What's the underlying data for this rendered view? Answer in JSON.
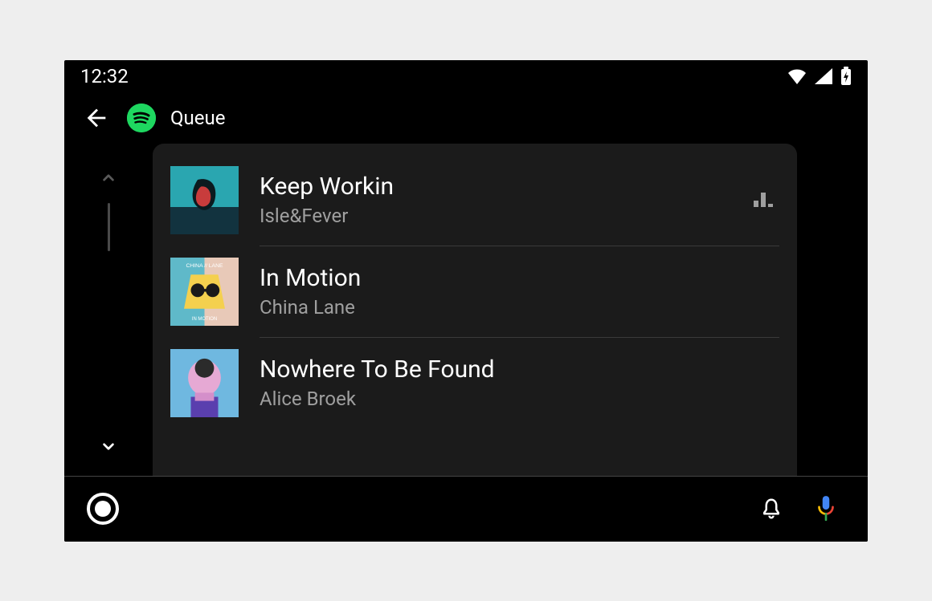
{
  "statusbar": {
    "time": "12:32"
  },
  "header": {
    "title": "Queue",
    "app_icon": "spotify-icon",
    "back_icon": "arrow-left-icon"
  },
  "queue": {
    "now_playing_indicator": "equalizer-icon",
    "tracks": [
      {
        "title": "Keep Workin",
        "artist": "Isle&Fever",
        "playing": true
      },
      {
        "title": "In Motion",
        "artist": "China Lane",
        "playing": false
      },
      {
        "title": "Nowhere To Be Found",
        "artist": "Alice Broek",
        "playing": false
      }
    ]
  },
  "scroll": {
    "up_icon": "chevron-up-icon",
    "down_icon": "chevron-down-icon"
  },
  "navbar": {
    "home_icon": "home-circle-icon",
    "bell_icon": "bell-icon",
    "mic_icon": "google-mic-icon"
  },
  "status_icons": {
    "wifi": "wifi-icon",
    "signal": "signal-icon",
    "battery": "battery-charging-icon"
  }
}
